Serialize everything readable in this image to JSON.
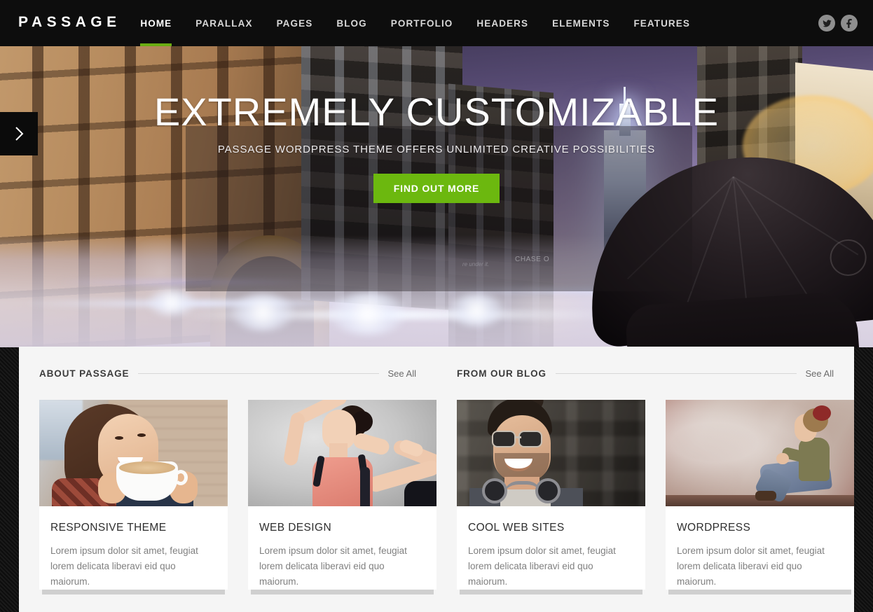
{
  "header": {
    "brand": "PASSAGE",
    "nav": [
      {
        "label": "HOME",
        "active": true
      },
      {
        "label": "PARALLAX",
        "active": false
      },
      {
        "label": "PAGES",
        "active": false
      },
      {
        "label": "BLOG",
        "active": false
      },
      {
        "label": "PORTFOLIO",
        "active": false
      },
      {
        "label": "HEADERS",
        "active": false
      },
      {
        "label": "ELEMENTS",
        "active": false
      },
      {
        "label": "FEATURES",
        "active": false
      }
    ],
    "social": [
      {
        "name": "twitter-icon",
        "label": "Twitter"
      },
      {
        "name": "facebook-icon",
        "label": "Facebook"
      }
    ],
    "accent_color": "#69ac12",
    "background_color": "#0d0d0d"
  },
  "hero": {
    "title": "EXTREMELY CUSTOMIZABLE",
    "subtitle": "PASSAGE WORDPRESS THEME OFFERS UNLIMITED CREATIVE POSSIBILITIES",
    "button_label": "FIND OUT MORE",
    "button_color": "#6cb80f",
    "slider_next_icon": "chevron-right-icon",
    "street_signs": {
      "bank": "CHASE O",
      "small": "re under it."
    }
  },
  "sections": [
    {
      "title": "ABOUT PASSAGE",
      "see_all": "See All",
      "cards": [
        {
          "title": "RESPONSIVE THEME",
          "text": "Lorem ipsum dolor sit amet, feugiat lorem delicata liberavi eid quo maiorum.",
          "image_alt": "woman-drinking-coffee"
        },
        {
          "title": "WEB DESIGN",
          "text": "Lorem ipsum dolor sit amet, feugiat lorem delicata liberavi eid quo maiorum.",
          "image_alt": "dancer-stretching"
        }
      ]
    },
    {
      "title": "FROM OUR BLOG",
      "see_all": "See All",
      "cards": [
        {
          "title": "COOL WEB SITES",
          "text": "Lorem ipsum dolor sit amet, feugiat lorem delicata liberavi eid quo maiorum.",
          "image_alt": "man-with-headphones"
        },
        {
          "title": "WORDPRESS",
          "text": "Lorem ipsum dolor sit amet, feugiat lorem delicata liberavi eid quo maiorum.",
          "image_alt": "woman-sitting-against-wall"
        }
      ]
    }
  ]
}
